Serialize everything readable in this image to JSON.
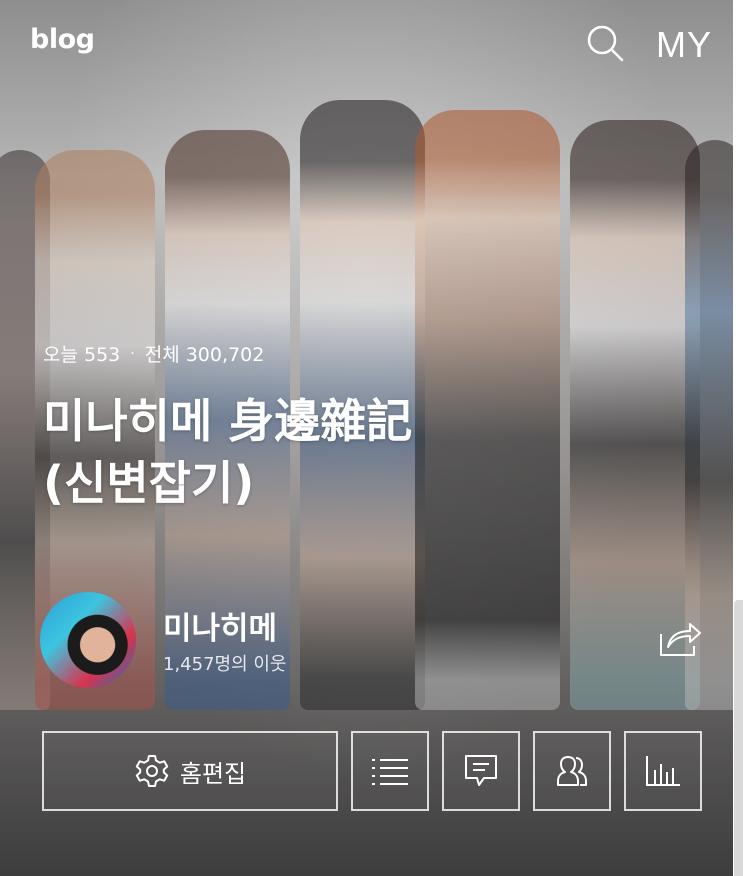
{
  "header": {
    "logo": "blog",
    "my_label": "MY",
    "icons": [
      "search-icon"
    ]
  },
  "stats": {
    "today": "오늘 553",
    "separator": "·",
    "total": "전체 300,702"
  },
  "blog": {
    "title": "미나히메 身邊雜記(신변잡기)"
  },
  "profile": {
    "nickname": "미나히메",
    "neighbors": "1,457명의 이웃",
    "icons": [
      "share-icon"
    ]
  },
  "actions": {
    "edit_label": "홈편집",
    "icons": [
      "gear-icon",
      "list-icon",
      "comment-icon",
      "neighbors-icon",
      "stats-icon"
    ]
  },
  "colors": {
    "text": "#ffffff",
    "button_border": "#ffffff"
  }
}
